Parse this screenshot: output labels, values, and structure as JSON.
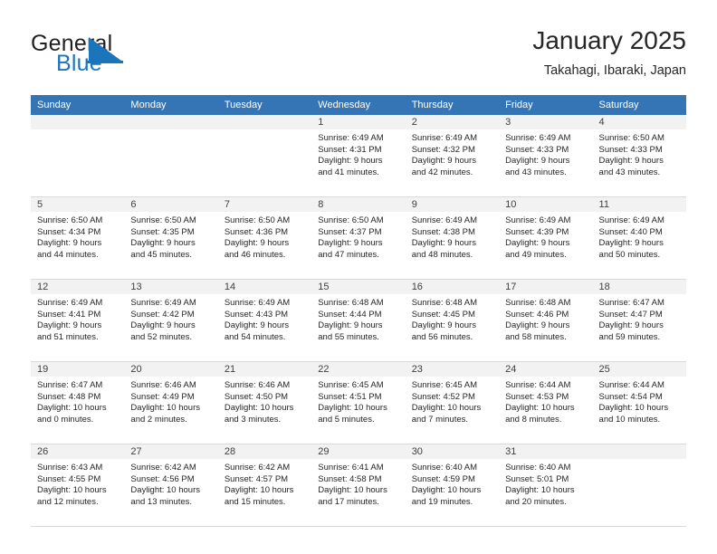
{
  "brand": {
    "word_general": "General",
    "word_blue": "Blue",
    "accent_color": "#1b75bb"
  },
  "header": {
    "title": "January 2025",
    "subtitle": "Takahagi, Ibaraki, Japan",
    "header_bg_color": "#3575b5"
  },
  "weekdays": [
    "Sunday",
    "Monday",
    "Tuesday",
    "Wednesday",
    "Thursday",
    "Friday",
    "Saturday"
  ],
  "labels": {
    "sunrise_prefix": "Sunrise: ",
    "sunset_prefix": "Sunset: ",
    "daylight_prefix": "Daylight: "
  },
  "weeks": [
    [
      {
        "empty": true
      },
      {
        "empty": true
      },
      {
        "empty": true
      },
      {
        "day": "1",
        "sunrise": "Sunrise: 6:49 AM",
        "sunset": "Sunset: 4:31 PM",
        "daylight1": "Daylight: 9 hours",
        "daylight2": "and 41 minutes."
      },
      {
        "day": "2",
        "sunrise": "Sunrise: 6:49 AM",
        "sunset": "Sunset: 4:32 PM",
        "daylight1": "Daylight: 9 hours",
        "daylight2": "and 42 minutes."
      },
      {
        "day": "3",
        "sunrise": "Sunrise: 6:49 AM",
        "sunset": "Sunset: 4:33 PM",
        "daylight1": "Daylight: 9 hours",
        "daylight2": "and 43 minutes."
      },
      {
        "day": "4",
        "sunrise": "Sunrise: 6:50 AM",
        "sunset": "Sunset: 4:33 PM",
        "daylight1": "Daylight: 9 hours",
        "daylight2": "and 43 minutes."
      }
    ],
    [
      {
        "day": "5",
        "sunrise": "Sunrise: 6:50 AM",
        "sunset": "Sunset: 4:34 PM",
        "daylight1": "Daylight: 9 hours",
        "daylight2": "and 44 minutes."
      },
      {
        "day": "6",
        "sunrise": "Sunrise: 6:50 AM",
        "sunset": "Sunset: 4:35 PM",
        "daylight1": "Daylight: 9 hours",
        "daylight2": "and 45 minutes."
      },
      {
        "day": "7",
        "sunrise": "Sunrise: 6:50 AM",
        "sunset": "Sunset: 4:36 PM",
        "daylight1": "Daylight: 9 hours",
        "daylight2": "and 46 minutes."
      },
      {
        "day": "8",
        "sunrise": "Sunrise: 6:50 AM",
        "sunset": "Sunset: 4:37 PM",
        "daylight1": "Daylight: 9 hours",
        "daylight2": "and 47 minutes."
      },
      {
        "day": "9",
        "sunrise": "Sunrise: 6:49 AM",
        "sunset": "Sunset: 4:38 PM",
        "daylight1": "Daylight: 9 hours",
        "daylight2": "and 48 minutes."
      },
      {
        "day": "10",
        "sunrise": "Sunrise: 6:49 AM",
        "sunset": "Sunset: 4:39 PM",
        "daylight1": "Daylight: 9 hours",
        "daylight2": "and 49 minutes."
      },
      {
        "day": "11",
        "sunrise": "Sunrise: 6:49 AM",
        "sunset": "Sunset: 4:40 PM",
        "daylight1": "Daylight: 9 hours",
        "daylight2": "and 50 minutes."
      }
    ],
    [
      {
        "day": "12",
        "sunrise": "Sunrise: 6:49 AM",
        "sunset": "Sunset: 4:41 PM",
        "daylight1": "Daylight: 9 hours",
        "daylight2": "and 51 minutes."
      },
      {
        "day": "13",
        "sunrise": "Sunrise: 6:49 AM",
        "sunset": "Sunset: 4:42 PM",
        "daylight1": "Daylight: 9 hours",
        "daylight2": "and 52 minutes."
      },
      {
        "day": "14",
        "sunrise": "Sunrise: 6:49 AM",
        "sunset": "Sunset: 4:43 PM",
        "daylight1": "Daylight: 9 hours",
        "daylight2": "and 54 minutes."
      },
      {
        "day": "15",
        "sunrise": "Sunrise: 6:48 AM",
        "sunset": "Sunset: 4:44 PM",
        "daylight1": "Daylight: 9 hours",
        "daylight2": "and 55 minutes."
      },
      {
        "day": "16",
        "sunrise": "Sunrise: 6:48 AM",
        "sunset": "Sunset: 4:45 PM",
        "daylight1": "Daylight: 9 hours",
        "daylight2": "and 56 minutes."
      },
      {
        "day": "17",
        "sunrise": "Sunrise: 6:48 AM",
        "sunset": "Sunset: 4:46 PM",
        "daylight1": "Daylight: 9 hours",
        "daylight2": "and 58 minutes."
      },
      {
        "day": "18",
        "sunrise": "Sunrise: 6:47 AM",
        "sunset": "Sunset: 4:47 PM",
        "daylight1": "Daylight: 9 hours",
        "daylight2": "and 59 minutes."
      }
    ],
    [
      {
        "day": "19",
        "sunrise": "Sunrise: 6:47 AM",
        "sunset": "Sunset: 4:48 PM",
        "daylight1": "Daylight: 10 hours",
        "daylight2": "and 0 minutes."
      },
      {
        "day": "20",
        "sunrise": "Sunrise: 6:46 AM",
        "sunset": "Sunset: 4:49 PM",
        "daylight1": "Daylight: 10 hours",
        "daylight2": "and 2 minutes."
      },
      {
        "day": "21",
        "sunrise": "Sunrise: 6:46 AM",
        "sunset": "Sunset: 4:50 PM",
        "daylight1": "Daylight: 10 hours",
        "daylight2": "and 3 minutes."
      },
      {
        "day": "22",
        "sunrise": "Sunrise: 6:45 AM",
        "sunset": "Sunset: 4:51 PM",
        "daylight1": "Daylight: 10 hours",
        "daylight2": "and 5 minutes."
      },
      {
        "day": "23",
        "sunrise": "Sunrise: 6:45 AM",
        "sunset": "Sunset: 4:52 PM",
        "daylight1": "Daylight: 10 hours",
        "daylight2": "and 7 minutes."
      },
      {
        "day": "24",
        "sunrise": "Sunrise: 6:44 AM",
        "sunset": "Sunset: 4:53 PM",
        "daylight1": "Daylight: 10 hours",
        "daylight2": "and 8 minutes."
      },
      {
        "day": "25",
        "sunrise": "Sunrise: 6:44 AM",
        "sunset": "Sunset: 4:54 PM",
        "daylight1": "Daylight: 10 hours",
        "daylight2": "and 10 minutes."
      }
    ],
    [
      {
        "day": "26",
        "sunrise": "Sunrise: 6:43 AM",
        "sunset": "Sunset: 4:55 PM",
        "daylight1": "Daylight: 10 hours",
        "daylight2": "and 12 minutes."
      },
      {
        "day": "27",
        "sunrise": "Sunrise: 6:42 AM",
        "sunset": "Sunset: 4:56 PM",
        "daylight1": "Daylight: 10 hours",
        "daylight2": "and 13 minutes."
      },
      {
        "day": "28",
        "sunrise": "Sunrise: 6:42 AM",
        "sunset": "Sunset: 4:57 PM",
        "daylight1": "Daylight: 10 hours",
        "daylight2": "and 15 minutes."
      },
      {
        "day": "29",
        "sunrise": "Sunrise: 6:41 AM",
        "sunset": "Sunset: 4:58 PM",
        "daylight1": "Daylight: 10 hours",
        "daylight2": "and 17 minutes."
      },
      {
        "day": "30",
        "sunrise": "Sunrise: 6:40 AM",
        "sunset": "Sunset: 4:59 PM",
        "daylight1": "Daylight: 10 hours",
        "daylight2": "and 19 minutes."
      },
      {
        "day": "31",
        "sunrise": "Sunrise: 6:40 AM",
        "sunset": "Sunset: 5:01 PM",
        "daylight1": "Daylight: 10 hours",
        "daylight2": "and 20 minutes."
      },
      {
        "empty": true
      }
    ]
  ]
}
